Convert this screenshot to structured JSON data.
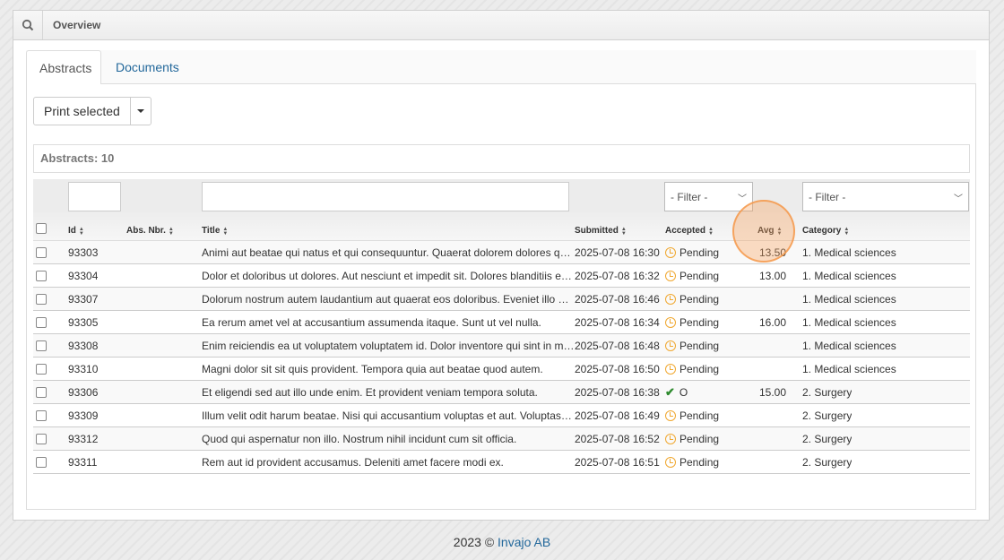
{
  "header": {
    "title": "Overview",
    "search_icon": "search-icon"
  },
  "tabs": [
    {
      "label": "Abstracts",
      "active": true
    },
    {
      "label": "Documents",
      "active": false
    }
  ],
  "toolbar": {
    "print_label": "Print selected"
  },
  "count_label": "Abstracts: 10",
  "filters": {
    "accepted": "- Filter -",
    "category": "- Filter -"
  },
  "columns": [
    "Id",
    "Abs. Nbr.",
    "Title",
    "Submitted",
    "Accepted",
    "Avg",
    "Category"
  ],
  "rows": [
    {
      "id": "93303",
      "abs": "",
      "title": "Animi aut beatae qui natus et qui consequuntur. Quaerat dolorem dolores quia et…",
      "submitted": "2025-07-08 16:30",
      "accepted": "Pending",
      "status": "pending",
      "avg": "13.50",
      "category": "1. Medical sciences"
    },
    {
      "id": "93304",
      "abs": "",
      "title": "Dolor et doloribus ut dolores. Aut nesciunt et impedit sit. Dolores blanditiis et inv…",
      "submitted": "2025-07-08 16:32",
      "accepted": "Pending",
      "status": "pending",
      "avg": "13.00",
      "category": "1. Medical sciences"
    },
    {
      "id": "93307",
      "abs": "",
      "title": "Dolorum nostrum autem laudantium aut quaerat eos doloribus. Eveniet illo omni…",
      "submitted": "2025-07-08 16:46",
      "accepted": "Pending",
      "status": "pending",
      "avg": "",
      "category": "1. Medical sciences"
    },
    {
      "id": "93305",
      "abs": "",
      "title": "Ea rerum amet vel at accusantium assumenda itaque. Sunt ut vel nulla.",
      "submitted": "2025-07-08 16:34",
      "accepted": "Pending",
      "status": "pending",
      "avg": "16.00",
      "category": "1. Medical sciences"
    },
    {
      "id": "93308",
      "abs": "",
      "title": "Enim reiciendis ea ut voluptatem voluptatem id. Dolor inventore qui sint in moles…",
      "submitted": "2025-07-08 16:48",
      "accepted": "Pending",
      "status": "pending",
      "avg": "",
      "category": "1. Medical sciences"
    },
    {
      "id": "93310",
      "abs": "",
      "title": "Magni dolor sit sit quis provident. Tempora quia aut beatae quod autem.",
      "submitted": "2025-07-08 16:50",
      "accepted": "Pending",
      "status": "pending",
      "avg": "",
      "category": "1. Medical sciences"
    },
    {
      "id": "93306",
      "abs": "",
      "title": "Et eligendi sed aut illo unde enim. Et provident veniam tempora soluta.",
      "submitted": "2025-07-08 16:38",
      "accepted": "O",
      "status": "accepted",
      "avg": "15.00",
      "category": "2. Surgery"
    },
    {
      "id": "93309",
      "abs": "",
      "title": "Illum velit odit harum beatae. Nisi qui accusantium voluptas et aut. Voluptas nobi…",
      "submitted": "2025-07-08 16:49",
      "accepted": "Pending",
      "status": "pending",
      "avg": "",
      "category": "2. Surgery"
    },
    {
      "id": "93312",
      "abs": "",
      "title": "Quod qui aspernatur non illo. Nostrum nihil incidunt cum sit officia.",
      "submitted": "2025-07-08 16:52",
      "accepted": "Pending",
      "status": "pending",
      "avg": "",
      "category": "2. Surgery"
    },
    {
      "id": "93311",
      "abs": "",
      "title": "Rem aut id provident accusamus. Deleniti amet facere modi ex.",
      "submitted": "2025-07-08 16:51",
      "accepted": "Pending",
      "status": "pending",
      "avg": "",
      "category": "2. Surgery"
    }
  ],
  "footer": {
    "copyright": "2023 ©",
    "company": "Invajo AB"
  },
  "colors": {
    "link": "#23689b",
    "pending": "#f0a830",
    "accepted": "#2d8a2d",
    "highlight": "#f5a050"
  }
}
